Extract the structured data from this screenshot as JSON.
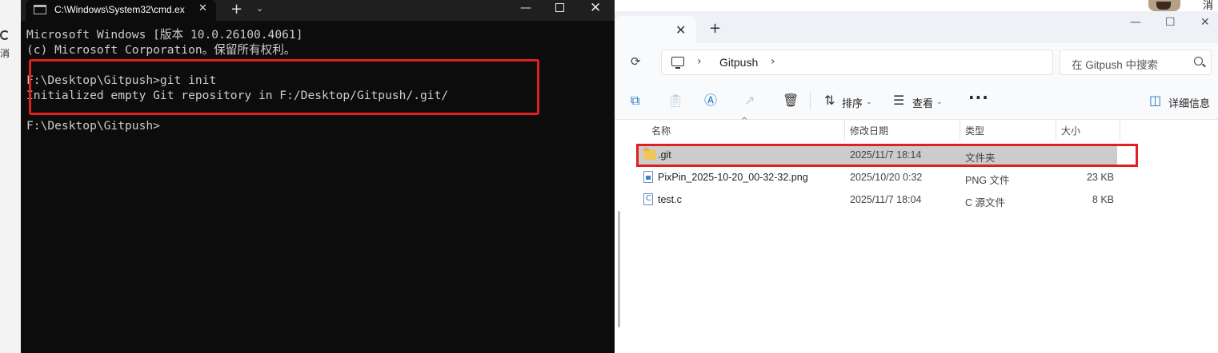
{
  "background": {
    "left_char": "消",
    "corner_char": "消"
  },
  "cmd_window": {
    "tab_title": "C:\\Windows\\System32\\cmd.ex",
    "new_tab": "+",
    "dropdown": "⌄",
    "min": "—",
    "close": "✕",
    "lines": [
      "Microsoft Windows [版本 10.0.26100.4061]",
      "(c) Microsoft Corporation。保留所有权利。",
      "",
      "F:\\Desktop\\Gitpush>git init",
      "Initialized empty Git repository in F:/Desktop/Gitpush/.git/",
      "",
      "F:\\Desktop\\Gitpush>"
    ],
    "highlight_color": "#e02020"
  },
  "explorer": {
    "tab_close": "✕",
    "new_tab": "+",
    "address": {
      "path": "Gitpush"
    },
    "search": {
      "placeholder": "在 Gitpush 中搜索"
    },
    "toolbar": {
      "sort_label": "排序",
      "view_label": "查看",
      "more": "···",
      "details_label": "详细信息"
    },
    "columns": {
      "name": "名称",
      "modified": "修改日期",
      "type": "类型",
      "size": "大小"
    },
    "files": [
      {
        "name": ".git",
        "modified": "2025/11/7 18:14",
        "type": "文件夹",
        "size": "",
        "icon": "folder-icon",
        "selected": true
      },
      {
        "name": "PixPin_2025-10-20_00-32-32.png",
        "modified": "2025/10/20 0:32",
        "type": "PNG 文件",
        "size": "23 KB",
        "icon": "image-file-icon",
        "selected": false
      },
      {
        "name": "test.c",
        "modified": "2025/11/7 18:04",
        "type": "C 源文件",
        "size": "8 KB",
        "icon": "c-file-icon",
        "selected": false
      }
    ],
    "highlight_color": "#e02020"
  }
}
